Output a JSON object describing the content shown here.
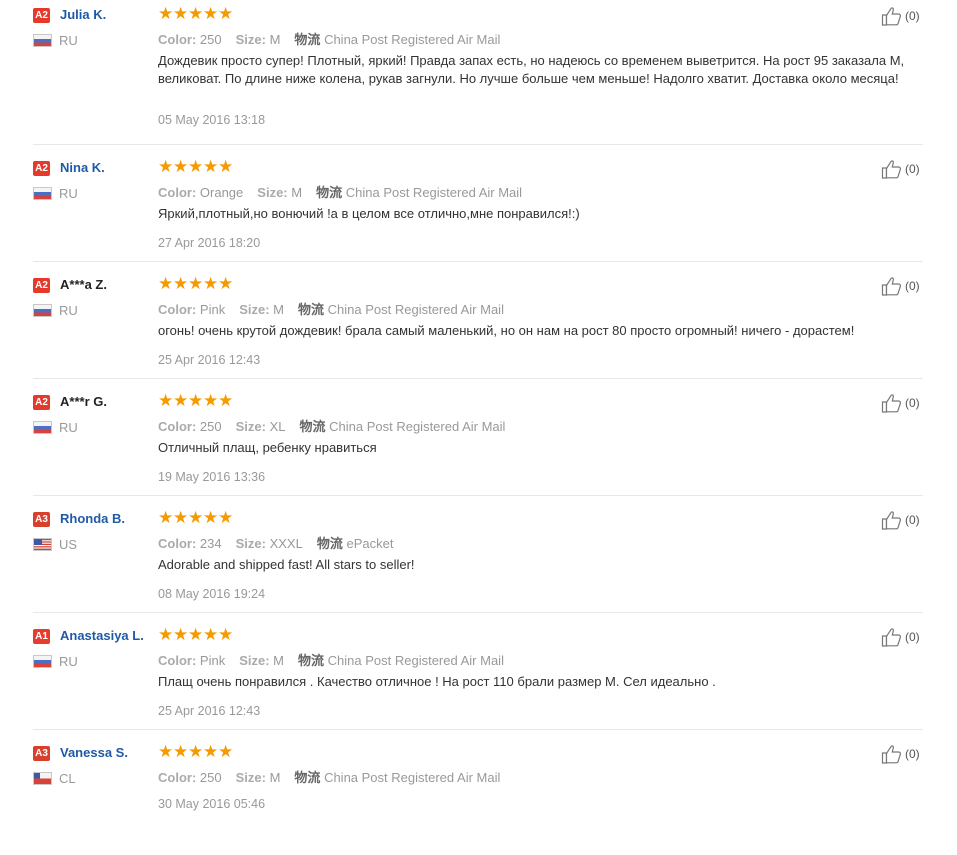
{
  "labels": {
    "color": "Color:",
    "size": "Size:",
    "shipping": "物流"
  },
  "colors": {
    "star": "#f59a00",
    "name_link": "#1f5aa6",
    "badge": "#e4392b"
  },
  "reviews": [
    {
      "badge": "A2",
      "name": "Julia K.",
      "country": "RU",
      "flag": "ru",
      "stars": 5,
      "color": "250",
      "size": "M",
      "shipping": "China Post Registered Air Mail",
      "text": "Дождевик просто супер! Плотный, яркий! Правда запах есть, но надеюсь со временем выветрится. На рост 95 заказала М, великоват. По длине ниже колена, рукав загнули. Но лучше больше чем меньше! Надолго хватит. Доставка около месяца!",
      "date": "05 May 2016 13:18",
      "helpful": "(0)"
    },
    {
      "badge": "A2",
      "name": "Nina K.",
      "country": "RU",
      "flag": "ru",
      "stars": 5,
      "color": "Orange",
      "size": "M",
      "shipping": "China Post Registered Air Mail",
      "text": "Яркий,плотный,но вонючий !а в целом все отлично,мне понравился!:)",
      "date": "27 Apr 2016 18:20",
      "helpful": "(0)"
    },
    {
      "badge": "A2",
      "name": "A***a Z.",
      "country": "RU",
      "flag": "ru",
      "stars": 5,
      "color": "Pink",
      "size": "M",
      "shipping": "China Post Registered Air Mail",
      "text": "огонь! очень крутой дождевик! брала самый маленький, но он нам на рост 80 просто огромный! ничего - дорастем!",
      "date": "25 Apr 2016 12:43",
      "helpful": "(0)"
    },
    {
      "badge": "A2",
      "name": "A***r G.",
      "country": "RU",
      "flag": "ru",
      "stars": 5,
      "color": "250",
      "size": "XL",
      "shipping": "China Post Registered Air Mail",
      "text": "Отличный плащ, ребенку нравиться",
      "date": "19 May 2016 13:36",
      "helpful": "(0)"
    },
    {
      "badge": "A3",
      "name": "Rhonda B.",
      "country": "US",
      "flag": "us",
      "stars": 5,
      "color": "234",
      "size": "XXXL",
      "shipping": "ePacket",
      "text": "Adorable and shipped fast! All stars to seller!",
      "date": "08 May 2016 19:24",
      "helpful": "(0)"
    },
    {
      "badge": "A1",
      "name": "Anastasiya L.",
      "country": "RU",
      "flag": "ru",
      "stars": 5,
      "color": "Pink",
      "size": "M",
      "shipping": "China Post Registered Air Mail",
      "text": "Плащ очень понравился . Качество отличное ! На рост 110 брали размер М. Сел идеально .",
      "date": "25 Apr 2016 12:43",
      "helpful": "(0)"
    },
    {
      "badge": "A3",
      "name": "Vanessa S.",
      "country": "CL",
      "flag": "cl",
      "stars": 5,
      "color": "250",
      "size": "M",
      "shipping": "China Post Registered Air Mail",
      "text": "",
      "date": "30 May 2016 05:46",
      "helpful": "(0)"
    }
  ]
}
